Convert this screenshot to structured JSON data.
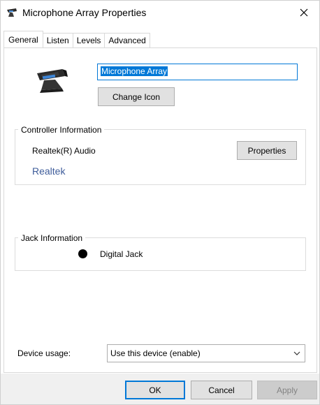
{
  "window": {
    "title": "Microphone Array Properties",
    "close_glyph": "✕"
  },
  "tabs": [
    {
      "label": "General",
      "active": true
    },
    {
      "label": "Listen",
      "active": false
    },
    {
      "label": "Levels",
      "active": false
    },
    {
      "label": "Advanced",
      "active": false
    }
  ],
  "general": {
    "device_name": "Microphone Array",
    "change_icon_label": "Change Icon",
    "controller": {
      "group_label": "Controller Information",
      "name": "Realtek(R) Audio",
      "vendor_link": "Realtek",
      "properties_label": "Properties"
    },
    "jack": {
      "group_label": "Jack Information",
      "jack_name": "Digital Jack"
    },
    "usage": {
      "label": "Device usage:",
      "selected": "Use this device (enable)"
    }
  },
  "footer": {
    "ok_label": "OK",
    "cancel_label": "Cancel",
    "apply_label": "Apply"
  },
  "colors": {
    "accent": "#0078d7",
    "link": "#3e5c9a"
  },
  "icons": {
    "title": "microphone-array-icon",
    "device": "microphone-array-device-icon",
    "close": "close-icon",
    "dropdown": "chevron-down-icon"
  }
}
